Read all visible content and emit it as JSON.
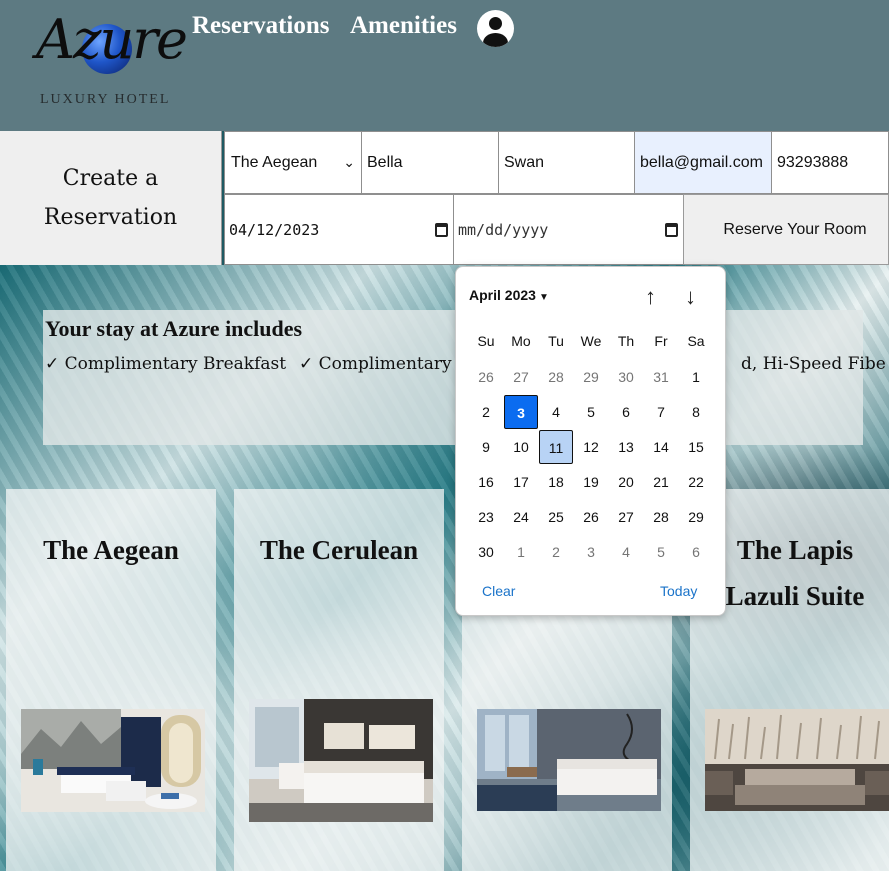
{
  "header": {
    "logo_script": "Azure",
    "logo_subtitle": "LUXURY HOTEL",
    "nav": [
      "Reservations",
      "Amenities"
    ],
    "avatar_icon": "user-icon"
  },
  "form": {
    "heading_line1": "Create a",
    "heading_line2": "Reservation",
    "room_select": "The Aegean",
    "first_name": "Bella",
    "last_name": "Swan",
    "email": "bella@gmail.com",
    "phone": "93293888",
    "checkin": "04/12/2023",
    "checkout_placeholder": "mm/dd/yyyy",
    "reserve_label": "Reserve Your Room"
  },
  "amenities": {
    "title": "Your stay at Azure includes",
    "item1": "✓ Complimentary Breakfast",
    "item2": "✓ Complimentary",
    "item3": "d, Hi-Speed Fibe"
  },
  "rooms": [
    {
      "line1": "The Aegean",
      "line2": ""
    },
    {
      "line1": "The Cerulean",
      "line2": ""
    },
    {
      "line1": "",
      "line2": ""
    },
    {
      "line1": "The Lapis",
      "line2": "Lazuli Suite"
    }
  ],
  "picker": {
    "month_label": "April 2023",
    "weekdays": [
      "Su",
      "Mo",
      "Tu",
      "We",
      "Th",
      "Fr",
      "Sa"
    ],
    "days": [
      [
        "26",
        "27",
        "28",
        "29",
        "30",
        "31",
        "1"
      ],
      [
        "2",
        "3",
        "4",
        "5",
        "6",
        "7",
        "8"
      ],
      [
        "9",
        "10",
        "11",
        "12",
        "13",
        "14",
        "15"
      ],
      [
        "16",
        "17",
        "18",
        "19",
        "20",
        "21",
        "22"
      ],
      [
        "23",
        "24",
        "25",
        "26",
        "27",
        "28",
        "29"
      ],
      [
        "30",
        "1",
        "2",
        "3",
        "4",
        "5",
        "6"
      ]
    ],
    "selected_day": "3",
    "today_day": "11",
    "clear_label": "Clear",
    "today_label": "Today"
  },
  "colors": {
    "header_bg": "#5d7a82",
    "selected_day": "#0b6cf0",
    "today_day": "#b8d3f5",
    "link": "#1a73c9",
    "autofill": "#e8f0fe"
  }
}
